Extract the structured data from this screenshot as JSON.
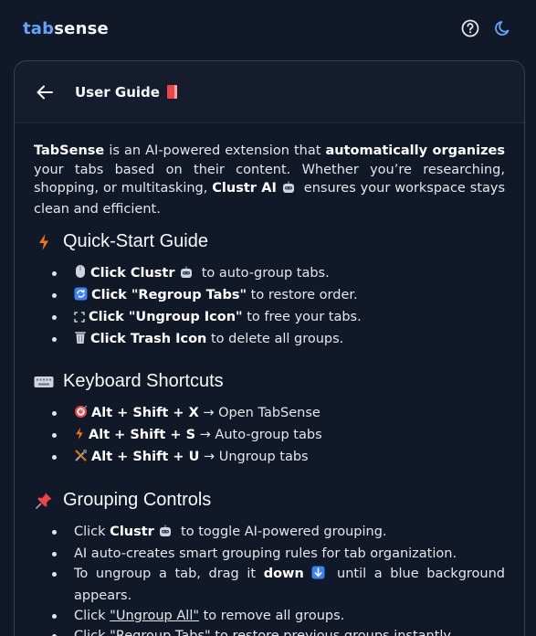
{
  "app": {
    "logo_part1": "tab",
    "logo_part2": "sense"
  },
  "header": {
    "back_label": "Back",
    "title": "User Guide"
  },
  "intro": {
    "brand": "TabSense",
    "t1": " is an AI-powered extension that ",
    "bold1": "automatically organizes",
    "t2": " your tabs based on their content. Whether you’re researching, shopping, or multitasking, ",
    "bold2": "Clustr AI",
    "t3": " ensures your workspace stays clean and efficient."
  },
  "quickstart": {
    "title": "Quick-Start Guide",
    "items": [
      {
        "bold": "Click Clustr",
        "rest": " to auto-group tabs."
      },
      {
        "bold": "Click \"Regroup Tabs\"",
        "rest": " to restore order."
      },
      {
        "bold": "Click \"Ungroup Icon\"",
        "rest": " to free your tabs."
      },
      {
        "bold": "Click Trash Icon",
        "rest": " to delete all groups."
      }
    ]
  },
  "shortcuts": {
    "title": "Keyboard Shortcuts",
    "items": [
      {
        "bold": "Alt + Shift + X",
        "rest": " → Open TabSense"
      },
      {
        "bold": "Alt + Shift + S",
        "rest": " → Auto-group tabs"
      },
      {
        "bold": "Alt + Shift + U",
        "rest": " → Ungroup tabs"
      }
    ]
  },
  "grouping": {
    "title": "Grouping Controls",
    "i1_pre": "Click ",
    "i1_bold": "Clustr",
    "i1_post": " to toggle AI-powered grouping.",
    "i2": "AI auto-creates smart grouping rules for tab organization.",
    "i3_pre": " To ungroup a tab, drag it ",
    "i3_bold": "down",
    "i3_post": " until a blue background appears.",
    "i4_pre": "Click ",
    "i4_link": "\"Ungroup All\"",
    "i4_post": " to remove all groups.",
    "i5_pre": "Click ",
    "i5_link": "\"Regroup Tabs\"",
    "i5_post": " to restore previous groups instantly."
  },
  "colors": {
    "background": "#111827",
    "accent": "#60a5fa",
    "border": "#374151"
  }
}
